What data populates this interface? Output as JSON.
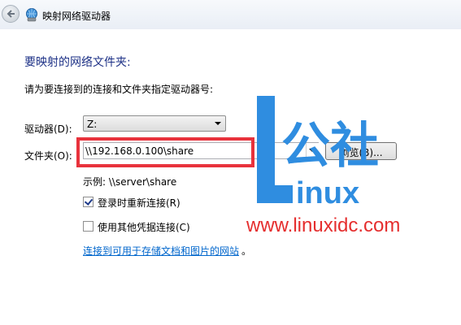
{
  "window": {
    "title": "映射网络驱动器",
    "icons": {
      "back": "back-arrow-icon",
      "app": "network-drive-icon"
    }
  },
  "heading": "要映射的网络文件夹:",
  "instruction": "请为要连接到的连接和文件夹指定驱动器号:",
  "drive": {
    "label": "驱动器(D):",
    "value": "Z:"
  },
  "folder": {
    "label": "文件夹(O):",
    "value": "\\\\192.168.0.100\\share",
    "browse_label": "浏览(B)..."
  },
  "example": "示例: \\\\server\\share",
  "options": {
    "reconnect": {
      "label": "登录时重新连接(R)",
      "checked": true
    },
    "other_credentials": {
      "label": "使用其他凭据连接(C)",
      "checked": false
    }
  },
  "link": {
    "text": "连接到可用于存储文档和图片的网站",
    "suffix": "。"
  },
  "watermark": {
    "logo_text": "公社",
    "logo_suffix": "inux",
    "url": "www.linuxidc.com"
  },
  "colors": {
    "heading": "#1e3287",
    "link": "#0066cc",
    "highlight": "#e8323c",
    "watermark_blue": "#2f8de0",
    "watermark_red": "#e52e2e"
  }
}
